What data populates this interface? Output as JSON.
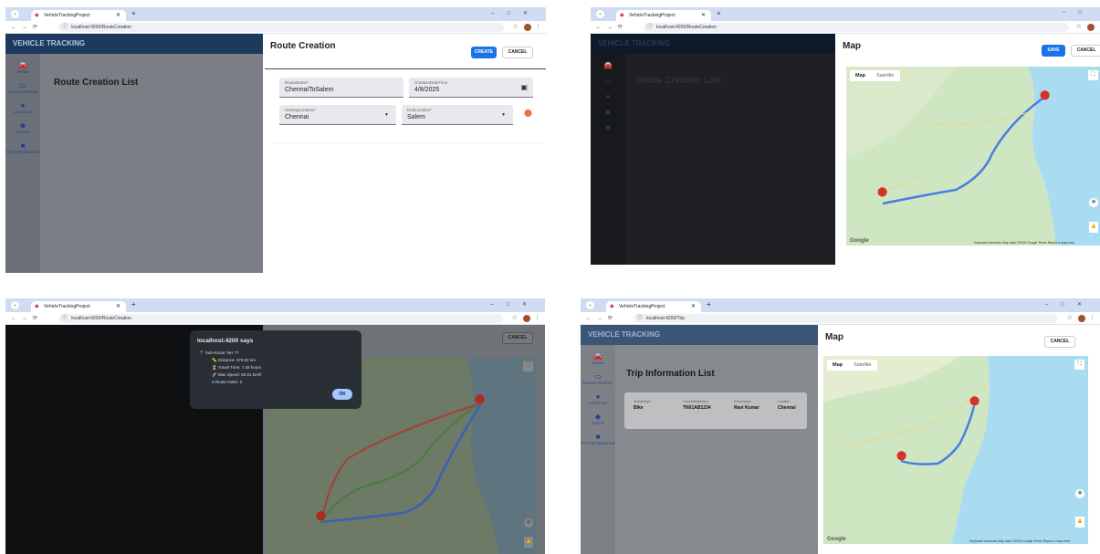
{
  "browser": {
    "tab_title": "VehicleTrackingProject",
    "url_route_creation": "localhost:4200/RouteCreation",
    "url_trip": "localhost:4200/Trip"
  },
  "app": {
    "brand": "VEHICLE TRACKING",
    "sidebar": [
      {
        "label": "Vehicle",
        "icon": "car-icon"
      },
      {
        "label": "DEVICE PROFILE",
        "icon": "device-icon"
      },
      {
        "label": "LOCATION",
        "icon": "location-pin-icon"
      },
      {
        "label": "ROUTE",
        "icon": "route-icon"
      },
      {
        "label": "TRIP INFORMATION",
        "icon": "truck-icon"
      }
    ],
    "route_list_title": "Route Creation List",
    "trip_list_title": "Trip Information List"
  },
  "route_form": {
    "title": "Route Creation",
    "create_label": "CREATE",
    "cancel_label": "CANCEL",
    "route_name_label": "RouteName*",
    "route_name_value": "ChennaiToSalem",
    "date_label": "CreationDateTime",
    "date_value": "4/8/2025",
    "start_label": "StartingLocation*",
    "start_value": "Chennai",
    "end_label": "EndLocation*",
    "end_value": "Salem"
  },
  "map_panel": {
    "title": "Map",
    "save_label": "SAVE",
    "cancel_label": "CANCEL",
    "map_tab": "Map",
    "satellite_tab": "Satellite",
    "footer": "Keyboard shortcuts   Map data ©2025 Google   Terms   Report a map error",
    "google": "Google"
  },
  "alert": {
    "title": "localhost:4200 says",
    "sub_route": "Sub-Route: NH 77",
    "distance": "Distance: 379.04 km",
    "travel_time": "Travel Time: 7.48 hours",
    "max_speed": "Max Speed: 50.61 km/h",
    "route_index": "Route Index: 2",
    "ok_label": "OK"
  },
  "trip_table": {
    "headers": [
      "VehicleType",
      "TravelVehicleNum",
      "DriverName",
      "Location"
    ],
    "row": [
      "Bike",
      "TN01AB1234",
      "Ravi Kumar",
      "Chennai"
    ]
  },
  "colors": {
    "route_blue": "#4a7ee0",
    "route_red": "#c5453a",
    "route_green": "#5c9a4c",
    "marker": "#d93025"
  }
}
